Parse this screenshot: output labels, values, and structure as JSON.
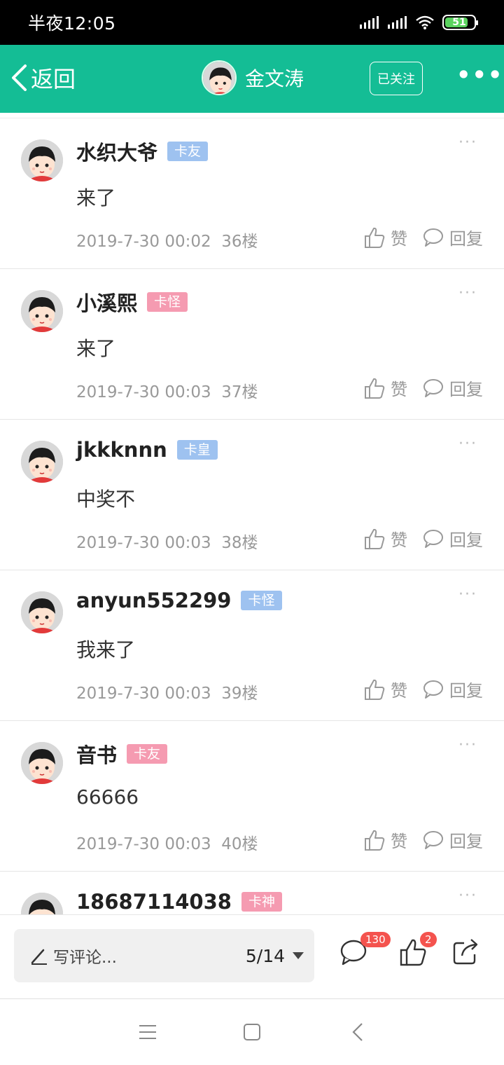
{
  "status_bar": {
    "time": "半夜12:05",
    "battery": "51"
  },
  "nav": {
    "back_label": "返回",
    "title": "金文涛",
    "follow_label": "已关注",
    "more": "•••"
  },
  "comments": [
    {
      "name": "水织大爷",
      "badge": "卡友",
      "badge_color": "#9ec2f0",
      "content": "来了",
      "time": "2019-7-30 00:02",
      "floor": "36楼"
    },
    {
      "name": "小溪熙",
      "badge": "卡怪",
      "badge_color": "#f59bb1",
      "content": "来了",
      "time": "2019-7-30 00:03",
      "floor": "37楼"
    },
    {
      "name": "jkkknnn",
      "badge": "卡皇",
      "badge_color": "#9ec2f0",
      "content": "中奖不",
      "time": "2019-7-30 00:03",
      "floor": "38楼"
    },
    {
      "name": "anyun552299",
      "badge": "卡怪",
      "badge_color": "#9ec2f0",
      "content": "我来了",
      "time": "2019-7-30 00:03",
      "floor": "39楼"
    },
    {
      "name": "音书",
      "badge": "卡友",
      "badge_color": "#f59bb1",
      "content": "66666",
      "time": "2019-7-30 00:03",
      "floor": "40楼"
    },
    {
      "name": "18687114038",
      "badge": "卡神",
      "badge_color": "#f59bb1",
      "content": "",
      "time": "",
      "floor": ""
    }
  ],
  "actions": {
    "like": "赞",
    "reply": "回复",
    "more": "···"
  },
  "bottom": {
    "placeholder": "写评论...",
    "page": "5/14",
    "comment_count": "130",
    "like_count": "2"
  },
  "colors": {
    "accent": "#14bd95"
  }
}
